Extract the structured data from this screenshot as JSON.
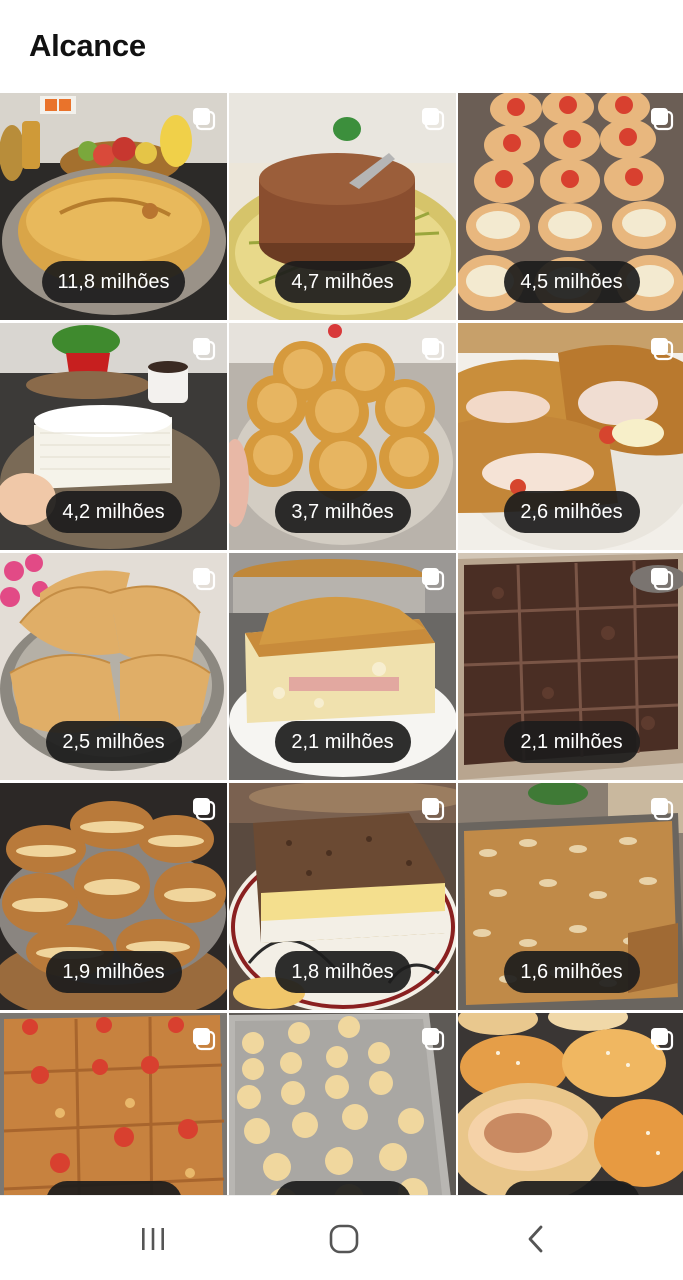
{
  "header": {
    "title": "Alcance"
  },
  "posts": [
    {
      "reach": "11,8 milhões",
      "image": "meat-pie-with-fruit-bowl"
    },
    {
      "reach": "4,7 milhões",
      "image": "chocolate-pudding-cake"
    },
    {
      "reach": "4,5 milhões",
      "image": "mini-pizzas-tray"
    },
    {
      "reach": "4,2 milhões",
      "image": "wafer-layer-cake"
    },
    {
      "reach": "3,7 milhões",
      "image": "empadas-pastries"
    },
    {
      "reach": "2,6 milhões",
      "image": "ham-cheese-stuffed-bread"
    },
    {
      "reach": "2,5 milhões",
      "image": "pastel-turnovers"
    },
    {
      "reach": "2,1 milhões",
      "image": "ham-cheese-savory-cake"
    },
    {
      "reach": "2,1 milhões",
      "image": "brownies-tray"
    },
    {
      "reach": "1,9 milhões",
      "image": "stuffed-bread-rolls"
    },
    {
      "reach": "1,8 milhões",
      "image": "layered-meat-cheese-pie"
    },
    {
      "reach": "1,6 milhões",
      "image": "almond-crumble-tray"
    },
    {
      "reach": "",
      "image": "tomato-topped-savory-squares"
    },
    {
      "reach": "",
      "image": "cheese-bread-balls-tray"
    },
    {
      "reach": "",
      "image": "filled-sweet-buns"
    }
  ],
  "navigation": {
    "recent_apps": "recent-apps-icon",
    "home": "home-icon",
    "back": "back-icon"
  },
  "colors": {
    "badge_background": "#1c1c1c",
    "badge_text": "#ffffff",
    "title_text": "#111111"
  }
}
